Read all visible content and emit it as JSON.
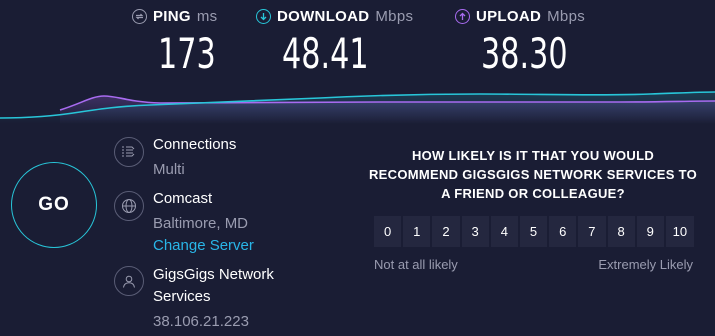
{
  "metrics": {
    "ping": {
      "label": "PING",
      "unit": "ms",
      "value": "173"
    },
    "download": {
      "label": "DOWNLOAD",
      "unit": "Mbps",
      "value": "48.41"
    },
    "upload": {
      "label": "UPLOAD",
      "unit": "Mbps",
      "value": "38.30"
    }
  },
  "colors": {
    "background": "#1a1d34",
    "download_accent": "#28c6d9",
    "upload_accent": "#a86bf0",
    "link": "#29b6e8"
  },
  "go_button": {
    "label": "GO"
  },
  "server_info": {
    "connections": {
      "icon": "connections-icon",
      "title": "Connections",
      "value": "Multi"
    },
    "server": {
      "icon": "globe-icon",
      "title": "Comcast",
      "location": "Baltimore, MD",
      "change_label": "Change Server"
    },
    "host": {
      "icon": "user-icon",
      "title_line1": "GigsGigs Network",
      "title_line2": "Services",
      "ip": "38.106.21.223"
    }
  },
  "survey": {
    "question_line1": "HOW LIKELY IS IT THAT YOU WOULD",
    "question_line2": "RECOMMEND GIGSGIGS NETWORK SERVICES TO",
    "question_line3": "A FRIEND OR COLLEAGUE?",
    "options": [
      "0",
      "1",
      "2",
      "3",
      "4",
      "5",
      "6",
      "7",
      "8",
      "9",
      "10"
    ],
    "low_label": "Not at all likely",
    "high_label": "Extremely Likely"
  }
}
